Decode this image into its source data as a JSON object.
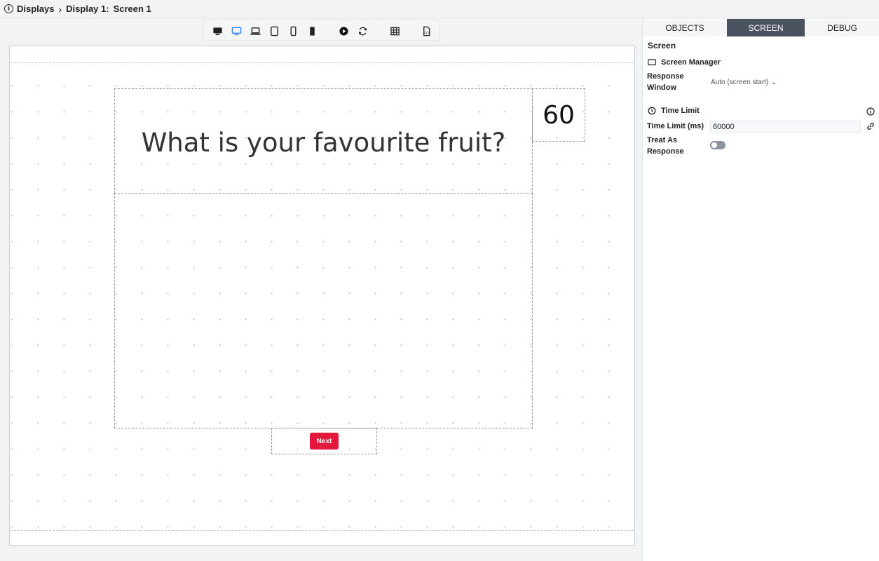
{
  "breadcrumb": {
    "root": "Displays",
    "display": "Display 1:",
    "screen": "Screen 1"
  },
  "toolbar": {
    "buttons": [
      {
        "icon": "desktop-icon",
        "active": false
      },
      {
        "icon": "monitor-icon",
        "active": true
      },
      {
        "icon": "laptop-icon",
        "active": false
      },
      {
        "icon": "tablet-icon",
        "active": false
      },
      {
        "icon": "phone-icon",
        "active": false
      },
      {
        "icon": "phone-filled-icon",
        "active": false
      },
      {
        "icon": "play-icon",
        "active": false
      },
      {
        "icon": "refresh-icon",
        "active": false
      },
      {
        "icon": "grid-icon",
        "active": false
      },
      {
        "icon": "file-code-icon",
        "active": false
      }
    ],
    "active_color": "#2f80ed"
  },
  "canvas": {
    "question": "What is your favourite fruit?",
    "timer": "60",
    "next_button": "Next",
    "next_color": "#e3183b"
  },
  "panel": {
    "tabs": [
      "OBJECTS",
      "SCREEN",
      "DEBUG"
    ],
    "active_tab": "SCREEN",
    "title": "Screen",
    "screen_manager": {
      "heading": "Screen Manager",
      "response_window_label_1": "Response",
      "response_window_label_2": "Window",
      "response_window_value": "Auto (screen start)"
    },
    "time_limit": {
      "heading": "Time Limit",
      "time_limit_label": "Time Limit (ms)",
      "time_limit_value": "60000",
      "treat_label_1": "Treat As",
      "treat_label_2": "Response",
      "treat_as_response": false
    }
  }
}
